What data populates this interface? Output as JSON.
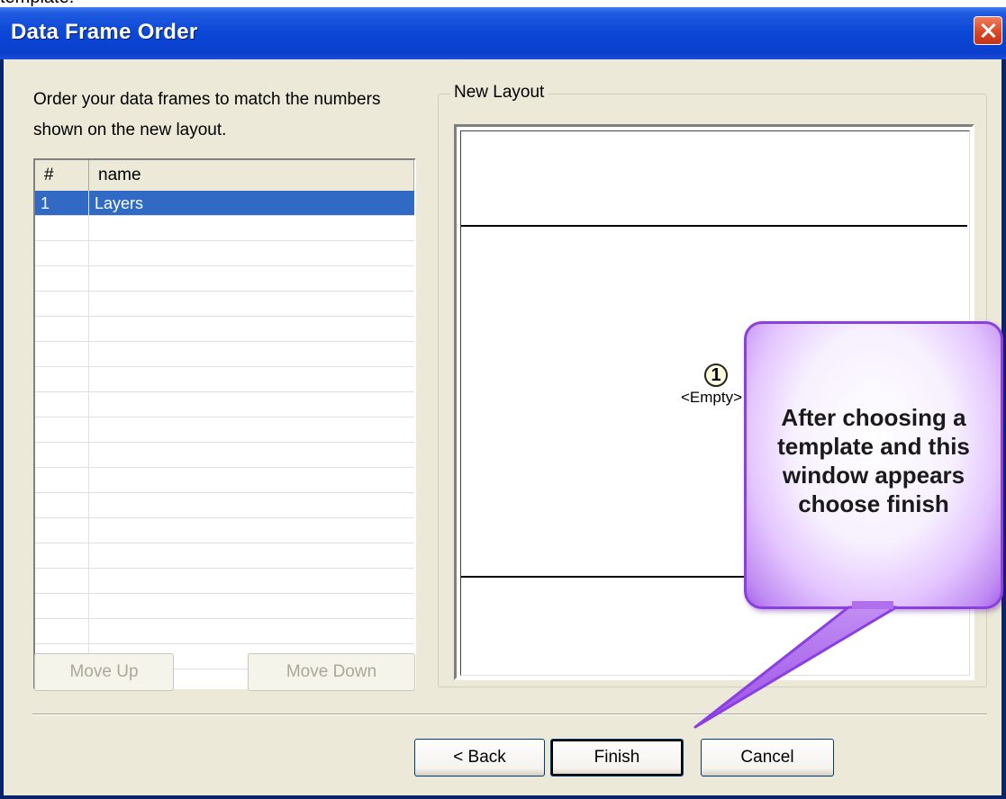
{
  "top_strip_text": "template.",
  "window": {
    "title": "Data Frame Order",
    "close_label": "Close"
  },
  "instructions": "Order your data frames to match the numbers shown on the new layout.",
  "list": {
    "columns": [
      "#",
      "name"
    ],
    "rows": [
      {
        "num": "1",
        "name": "Layers",
        "selected": true
      }
    ],
    "empty_row_count": 18
  },
  "buttons": {
    "move_up": "Move Up",
    "move_down": "Move Down",
    "back": "< Back",
    "finish": "Finish",
    "cancel": "Cancel"
  },
  "preview": {
    "group_label": "New Layout",
    "frame_number": "1",
    "frame_label": "<Empty>"
  },
  "callout": {
    "text": "After choosing a template and this window appears choose finish",
    "colors": {
      "fill_edge": "#a862ea",
      "border": "#8a3fe0"
    }
  },
  "colors": {
    "title_bar": "#0a47d6",
    "dialog_bg": "#ece9d8",
    "selection": "#316ac5"
  }
}
